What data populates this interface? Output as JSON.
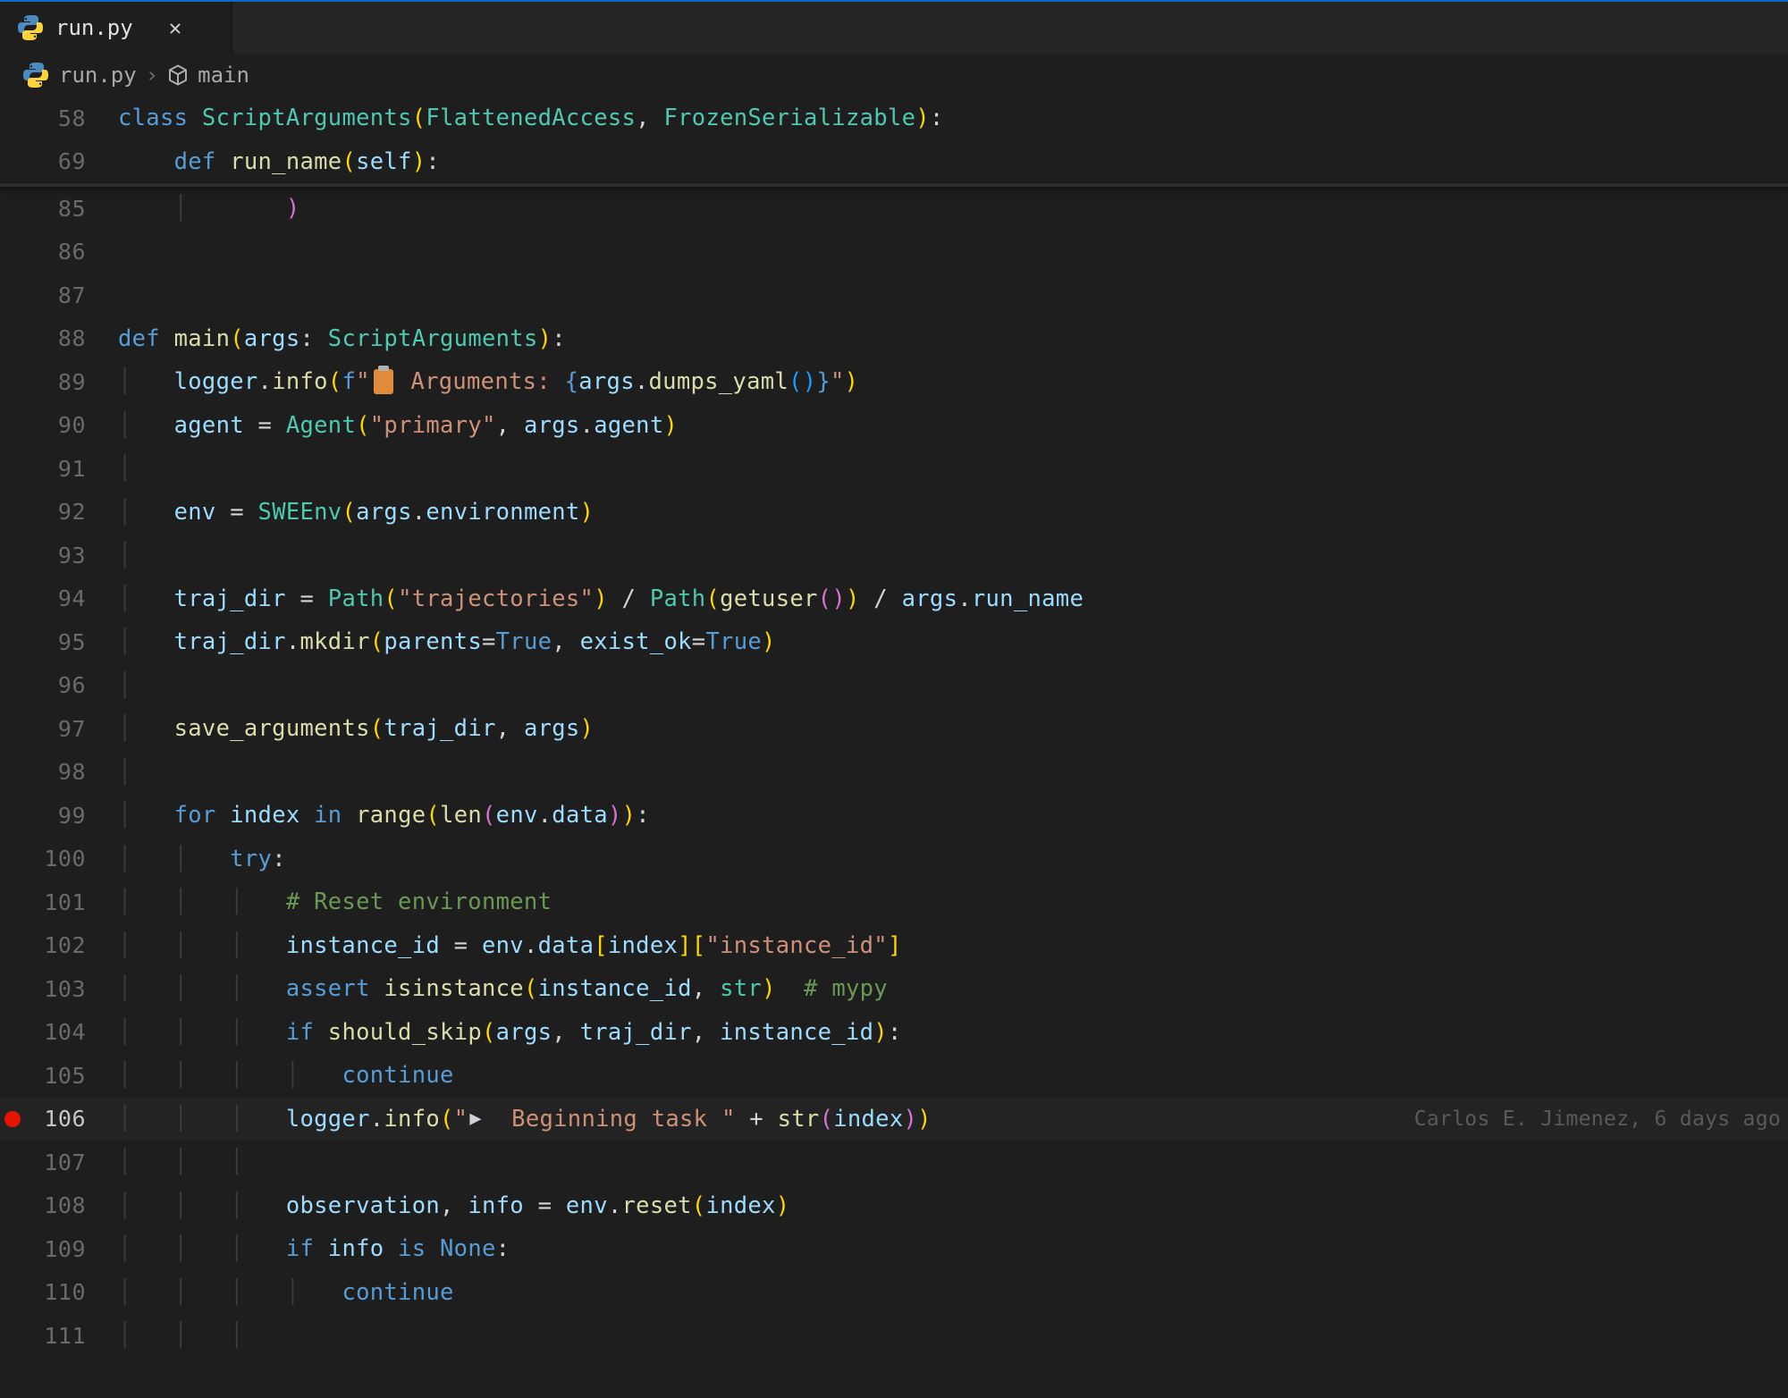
{
  "tab": {
    "filename": "run.py"
  },
  "breadcrumb": {
    "file": "run.py",
    "symbol_icon": "cube",
    "symbol": "main"
  },
  "blame": {
    "line106": "Carlos E. Jimenez, 6 days ago"
  },
  "gutter": {
    "breakpoint_line": 106
  },
  "lines": [
    {
      "n": 58,
      "sticky": true,
      "tokens": [
        [
          "kw",
          "class "
        ],
        [
          "cls",
          "ScriptArguments"
        ],
        [
          "yell",
          "("
        ],
        [
          "cls",
          "FlattenedAccess"
        ],
        [
          "punc",
          ", "
        ],
        [
          "cls",
          "FrozenSerializable"
        ],
        [
          "yell",
          ")"
        ],
        [
          "punc",
          ":"
        ]
      ]
    },
    {
      "n": 69,
      "sticky": true,
      "tokens": [
        [
          "punc",
          "    "
        ],
        [
          "kw",
          "def "
        ],
        [
          "fn",
          "run_name"
        ],
        [
          "yell",
          "("
        ],
        [
          "self",
          "self"
        ],
        [
          "yell",
          ")"
        ],
        [
          "punc",
          ":"
        ]
      ]
    },
    {
      "n": 85,
      "tokens": [
        [
          "ig",
          "    │   "
        ],
        [
          "punc",
          "    "
        ],
        [
          "pink",
          ")"
        ]
      ]
    },
    {
      "n": 86,
      "tokens": []
    },
    {
      "n": 87,
      "tokens": []
    },
    {
      "n": 88,
      "tokens": [
        [
          "kw",
          "def "
        ],
        [
          "fn",
          "main"
        ],
        [
          "yell",
          "("
        ],
        [
          "var",
          "args"
        ],
        [
          "punc",
          ": "
        ],
        [
          "cls",
          "ScriptArguments"
        ],
        [
          "yell",
          ")"
        ],
        [
          "punc",
          ":"
        ]
      ]
    },
    {
      "n": 89,
      "tokens": [
        [
          "ig",
          "│   "
        ],
        [
          "var",
          "logger"
        ],
        [
          "punc",
          "."
        ],
        [
          "fn",
          "info"
        ],
        [
          "yell",
          "("
        ],
        [
          "kw",
          "f"
        ],
        [
          "str",
          "\""
        ],
        [
          "emoji",
          "clipboard"
        ],
        [
          "str",
          " Arguments: "
        ],
        [
          "kw",
          "{"
        ],
        [
          "var",
          "args"
        ],
        [
          "punc",
          "."
        ],
        [
          "fn",
          "dumps_yaml"
        ],
        [
          "blueb",
          "()"
        ],
        [
          "kw",
          "}"
        ],
        [
          "str",
          "\""
        ],
        [
          "yell",
          ")"
        ]
      ]
    },
    {
      "n": 90,
      "tokens": [
        [
          "ig",
          "│   "
        ],
        [
          "var",
          "agent"
        ],
        [
          "op",
          " = "
        ],
        [
          "cls",
          "Agent"
        ],
        [
          "yell",
          "("
        ],
        [
          "str",
          "\"primary\""
        ],
        [
          "punc",
          ", "
        ],
        [
          "var",
          "args"
        ],
        [
          "punc",
          "."
        ],
        [
          "var",
          "agent"
        ],
        [
          "yell",
          ")"
        ]
      ]
    },
    {
      "n": 91,
      "tokens": [
        [
          "ig",
          "│"
        ]
      ]
    },
    {
      "n": 92,
      "tokens": [
        [
          "ig",
          "│   "
        ],
        [
          "var",
          "env"
        ],
        [
          "op",
          " = "
        ],
        [
          "cls",
          "SWEEnv"
        ],
        [
          "yell",
          "("
        ],
        [
          "var",
          "args"
        ],
        [
          "punc",
          "."
        ],
        [
          "var",
          "environment"
        ],
        [
          "yell",
          ")"
        ]
      ]
    },
    {
      "n": 93,
      "tokens": [
        [
          "ig",
          "│"
        ]
      ]
    },
    {
      "n": 94,
      "tokens": [
        [
          "ig",
          "│   "
        ],
        [
          "var",
          "traj_dir"
        ],
        [
          "op",
          " = "
        ],
        [
          "cls",
          "Path"
        ],
        [
          "yell",
          "("
        ],
        [
          "str",
          "\"trajectories\""
        ],
        [
          "yell",
          ")"
        ],
        [
          "op",
          " / "
        ],
        [
          "cls",
          "Path"
        ],
        [
          "yell",
          "("
        ],
        [
          "fn",
          "getuser"
        ],
        [
          "pink",
          "()"
        ],
        [
          "yell",
          ")"
        ],
        [
          "op",
          " / "
        ],
        [
          "var",
          "args"
        ],
        [
          "punc",
          "."
        ],
        [
          "var",
          "run_name"
        ]
      ]
    },
    {
      "n": 95,
      "tokens": [
        [
          "ig",
          "│   "
        ],
        [
          "var",
          "traj_dir"
        ],
        [
          "punc",
          "."
        ],
        [
          "fn",
          "mkdir"
        ],
        [
          "yell",
          "("
        ],
        [
          "var",
          "parents"
        ],
        [
          "op",
          "="
        ],
        [
          "kw",
          "True"
        ],
        [
          "punc",
          ", "
        ],
        [
          "var",
          "exist_ok"
        ],
        [
          "op",
          "="
        ],
        [
          "kw",
          "True"
        ],
        [
          "yell",
          ")"
        ]
      ]
    },
    {
      "n": 96,
      "tokens": [
        [
          "ig",
          "│"
        ]
      ]
    },
    {
      "n": 97,
      "tokens": [
        [
          "ig",
          "│   "
        ],
        [
          "fn",
          "save_arguments"
        ],
        [
          "yell",
          "("
        ],
        [
          "var",
          "traj_dir"
        ],
        [
          "punc",
          ", "
        ],
        [
          "var",
          "args"
        ],
        [
          "yell",
          ")"
        ]
      ]
    },
    {
      "n": 98,
      "tokens": [
        [
          "ig",
          "│"
        ]
      ]
    },
    {
      "n": 99,
      "tokens": [
        [
          "ig",
          "│   "
        ],
        [
          "kw",
          "for"
        ],
        [
          "punc",
          " "
        ],
        [
          "var",
          "index"
        ],
        [
          "punc",
          " "
        ],
        [
          "kw",
          "in"
        ],
        [
          "punc",
          " "
        ],
        [
          "fn",
          "range"
        ],
        [
          "yell",
          "("
        ],
        [
          "fn",
          "len"
        ],
        [
          "pink",
          "("
        ],
        [
          "var",
          "env"
        ],
        [
          "punc",
          "."
        ],
        [
          "var",
          "data"
        ],
        [
          "pink",
          ")"
        ],
        [
          "yell",
          ")"
        ],
        [
          "punc",
          ":"
        ]
      ]
    },
    {
      "n": 100,
      "tokens": [
        [
          "ig",
          "│   │   "
        ],
        [
          "kw",
          "try"
        ],
        [
          "punc",
          ":"
        ]
      ]
    },
    {
      "n": 101,
      "tokens": [
        [
          "ig",
          "│   │   │   "
        ],
        [
          "cmt",
          "# Reset environment"
        ]
      ]
    },
    {
      "n": 102,
      "tokens": [
        [
          "ig",
          "│   │   │   "
        ],
        [
          "var",
          "instance_id"
        ],
        [
          "op",
          " = "
        ],
        [
          "var",
          "env"
        ],
        [
          "punc",
          "."
        ],
        [
          "var",
          "data"
        ],
        [
          "yell",
          "["
        ],
        [
          "var",
          "index"
        ],
        [
          "yell",
          "]"
        ],
        [
          "yell",
          "["
        ],
        [
          "str",
          "\"instance_id\""
        ],
        [
          "yell",
          "]"
        ]
      ]
    },
    {
      "n": 103,
      "tokens": [
        [
          "ig",
          "│   │   │   "
        ],
        [
          "kw",
          "assert"
        ],
        [
          "punc",
          " "
        ],
        [
          "fn",
          "isinstance"
        ],
        [
          "yell",
          "("
        ],
        [
          "var",
          "instance_id"
        ],
        [
          "punc",
          ", "
        ],
        [
          "cls",
          "str"
        ],
        [
          "yell",
          ")"
        ],
        [
          "punc",
          "  "
        ],
        [
          "cmt",
          "# mypy"
        ]
      ]
    },
    {
      "n": 104,
      "tokens": [
        [
          "ig",
          "│   │   │   "
        ],
        [
          "kw",
          "if"
        ],
        [
          "punc",
          " "
        ],
        [
          "fn",
          "should_skip"
        ],
        [
          "yell",
          "("
        ],
        [
          "var",
          "args"
        ],
        [
          "punc",
          ", "
        ],
        [
          "var",
          "traj_dir"
        ],
        [
          "punc",
          ", "
        ],
        [
          "var",
          "instance_id"
        ],
        [
          "yell",
          ")"
        ],
        [
          "punc",
          ":"
        ]
      ]
    },
    {
      "n": 105,
      "tokens": [
        [
          "ig",
          "│   │   │   │   "
        ],
        [
          "kw",
          "continue"
        ]
      ]
    },
    {
      "n": 106,
      "hl": true,
      "bp": true,
      "blame": "line106",
      "tokens": [
        [
          "ig",
          "│   │   │   "
        ],
        [
          "var",
          "logger"
        ],
        [
          "punc",
          "."
        ],
        [
          "fn",
          "info"
        ],
        [
          "yell",
          "("
        ],
        [
          "str",
          "\""
        ],
        [
          "emoji",
          "triangle"
        ],
        [
          "str",
          "  Beginning task \""
        ],
        [
          "op",
          " + "
        ],
        [
          "fn",
          "str"
        ],
        [
          "pink",
          "("
        ],
        [
          "var",
          "index"
        ],
        [
          "pink",
          ")"
        ],
        [
          "yell",
          ")"
        ]
      ]
    },
    {
      "n": 107,
      "tokens": [
        [
          "ig",
          "│   │   │"
        ]
      ]
    },
    {
      "n": 108,
      "tokens": [
        [
          "ig",
          "│   │   │   "
        ],
        [
          "var",
          "observation"
        ],
        [
          "punc",
          ", "
        ],
        [
          "var",
          "info"
        ],
        [
          "op",
          " = "
        ],
        [
          "var",
          "env"
        ],
        [
          "punc",
          "."
        ],
        [
          "fn",
          "reset"
        ],
        [
          "yell",
          "("
        ],
        [
          "var",
          "index"
        ],
        [
          "yell",
          ")"
        ]
      ]
    },
    {
      "n": 109,
      "tokens": [
        [
          "ig",
          "│   │   │   "
        ],
        [
          "kw",
          "if"
        ],
        [
          "punc",
          " "
        ],
        [
          "var",
          "info"
        ],
        [
          "punc",
          " "
        ],
        [
          "kw",
          "is"
        ],
        [
          "punc",
          " "
        ],
        [
          "kw",
          "None"
        ],
        [
          "punc",
          ":"
        ]
      ]
    },
    {
      "n": 110,
      "tokens": [
        [
          "ig",
          "│   │   │   │   "
        ],
        [
          "kw",
          "continue"
        ]
      ]
    },
    {
      "n": 111,
      "tokens": [
        [
          "ig",
          "│   │   │"
        ]
      ]
    }
  ]
}
